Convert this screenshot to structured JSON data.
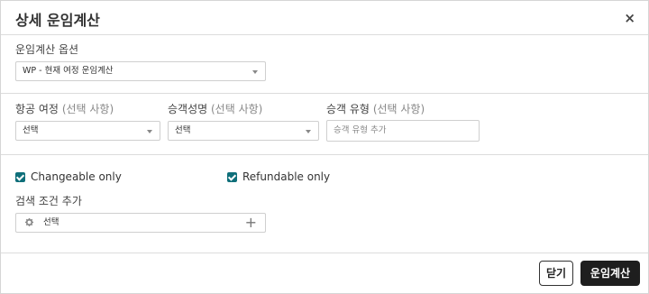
{
  "dialog": {
    "title": "상세 운임계산",
    "close_glyph": "×"
  },
  "fare_option": {
    "label": "운임계산 옵션",
    "selected": "WP - 현재 여정 운임계산"
  },
  "filters": {
    "itinerary": {
      "label": "항공 여정",
      "optional": "(선택 사항)",
      "value": "선택"
    },
    "passenger_name": {
      "label": "승객성명",
      "optional": "(선택 사항)",
      "value": "선택"
    },
    "passenger_type": {
      "label": "승객 유형",
      "optional": "(선택 사항)",
      "placeholder": "승객 유형 추가"
    }
  },
  "checks": {
    "changeable": {
      "label": "Changeable only",
      "checked": true
    },
    "refundable": {
      "label": "Refundable only",
      "checked": true
    }
  },
  "search_conditions": {
    "label": "검색 조건 추가",
    "value": "선택",
    "add_glyph": "+"
  },
  "footer": {
    "close_label": "닫기",
    "calc_label": "운임계산"
  },
  "colors": {
    "checkbox": "#0f6f7a",
    "primary_button": "#1e1e1e"
  }
}
